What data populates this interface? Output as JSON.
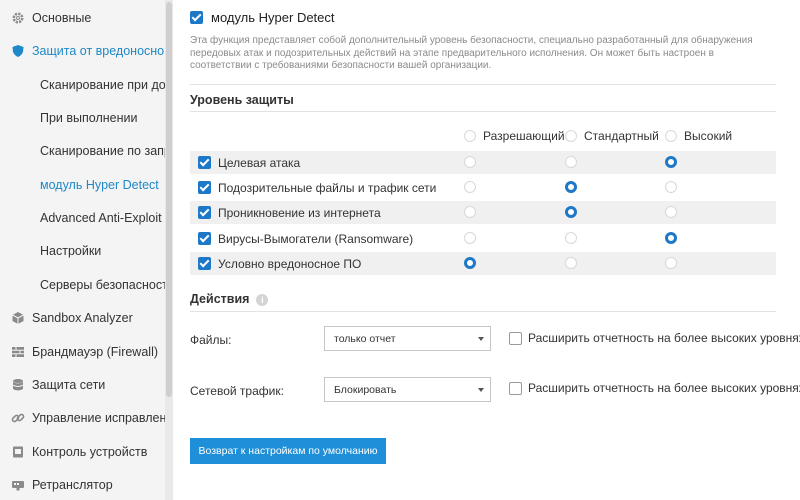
{
  "sidebar": {
    "items": [
      {
        "label": "Основные",
        "icon": "gear-icon"
      },
      {
        "label": "Защита от вредоносного",
        "icon": "shield-icon"
      },
      {
        "label": "Сканирование при доступе"
      },
      {
        "label": "При выполнении"
      },
      {
        "label": "Сканирование по запросу"
      },
      {
        "label": "модуль Hyper Detect"
      },
      {
        "label": "Advanced Anti-Exploit"
      },
      {
        "label": "Настройки"
      },
      {
        "label": "Серверы безопасности"
      },
      {
        "label": "Sandbox Analyzer",
        "icon": "cube-icon"
      },
      {
        "label": "Брандмауэр (Firewall)",
        "icon": "firewall-icon"
      },
      {
        "label": "Защита сети",
        "icon": "database-icon"
      },
      {
        "label": "Управление исправлениями",
        "icon": "link-icon"
      },
      {
        "label": "Контроль устройств",
        "icon": "device-icon"
      },
      {
        "label": "Ретранслятор",
        "icon": "relay-icon"
      }
    ],
    "accent_color": "#1e88c8"
  },
  "module": {
    "title": "модуль Hyper Detect",
    "enabled": true,
    "description": "Эта функция представляет собой дополнительный уровень безопасности, специально разработанный для обнаружения передовых атак и подозрительных действий на этапе предварительного исполнения. Он может быть настроен в соответствии с требованиями безопасности вашей организации."
  },
  "protection": {
    "title": "Уровень защиты",
    "levels": [
      "Разрешающий",
      "Стандартный",
      "Высокий"
    ],
    "rows": [
      {
        "label": "Целевая атака",
        "checked": true,
        "level": "Высокий"
      },
      {
        "label": "Подозрительные файлы и трафик сети",
        "checked": true,
        "level": "Стандартный"
      },
      {
        "label": "Проникновение из интернета",
        "checked": true,
        "level": "Стандартный"
      },
      {
        "label": "Вирусы-Вымогатели (Ransomware)",
        "checked": true,
        "level": "Высокий"
      },
      {
        "label": "Условно вредоносное ПО",
        "checked": true,
        "level": "Разрешающий"
      }
    ]
  },
  "actions": {
    "title": "Действия",
    "files": {
      "label": "Файлы:",
      "value": "только отчет",
      "extend_label": "Расширить отчетность на более высоких уровнях",
      "extend_checked": false
    },
    "traffic": {
      "label": "Сетевой трафик:",
      "value": "Блокировать",
      "extend_label": "Расширить отчетность на более высоких уровнях",
      "extend_checked": false
    }
  },
  "reset_button": "Возврат к настройкам по умолчанию",
  "colors": {
    "primary": "#1e78c8",
    "button": "#1e8fd8",
    "row_shade": "#f0f0f0",
    "sidebar_bg": "#f4f4f4"
  }
}
